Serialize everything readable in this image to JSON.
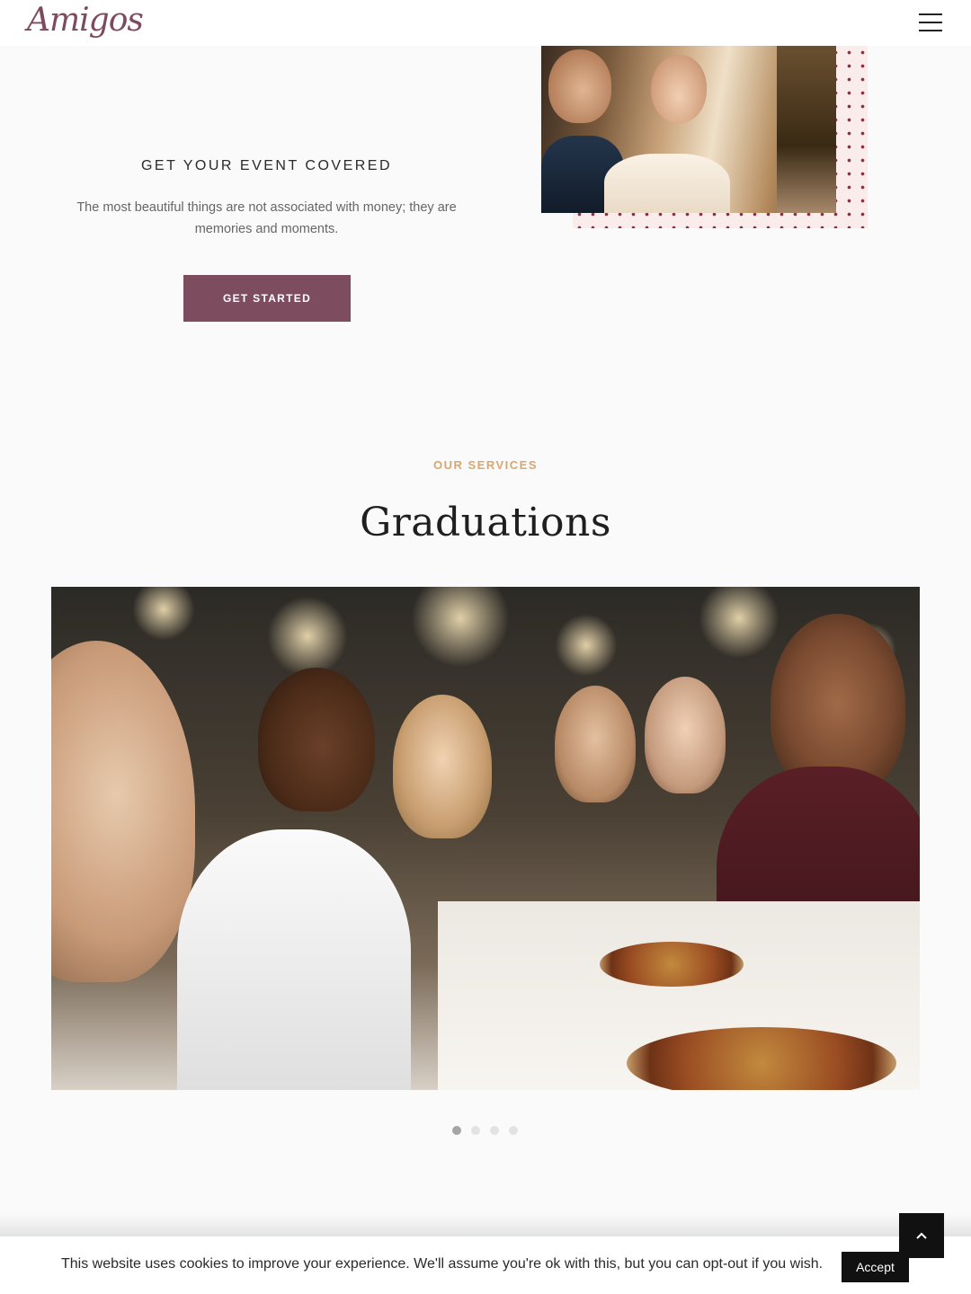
{
  "header": {
    "logo_text": "Amigos",
    "menu_icon": "hamburger-menu-icon"
  },
  "hero": {
    "title": "GET YOUR EVENT COVERED",
    "text": "The most beautiful things are not associated with money; they are memories and moments.",
    "button_label": "GET STARTED"
  },
  "services": {
    "label": "OUR SERVICES",
    "title": "Graduations",
    "slides_total": 4,
    "active_slide": 1
  },
  "cookie": {
    "text": "This website uses cookies to improve your experience. We'll assume you're ok with this, but you can opt-out if you wish.",
    "accept_label": "Accept"
  },
  "scroll_top": {
    "icon": "chevron-up-icon"
  },
  "colors": {
    "accent": "#7e4c5f",
    "label_gold": "#d9a66d",
    "dots_pink": "#fbecec",
    "dots_red": "#8c2f45",
    "background": "#fbfafa"
  }
}
